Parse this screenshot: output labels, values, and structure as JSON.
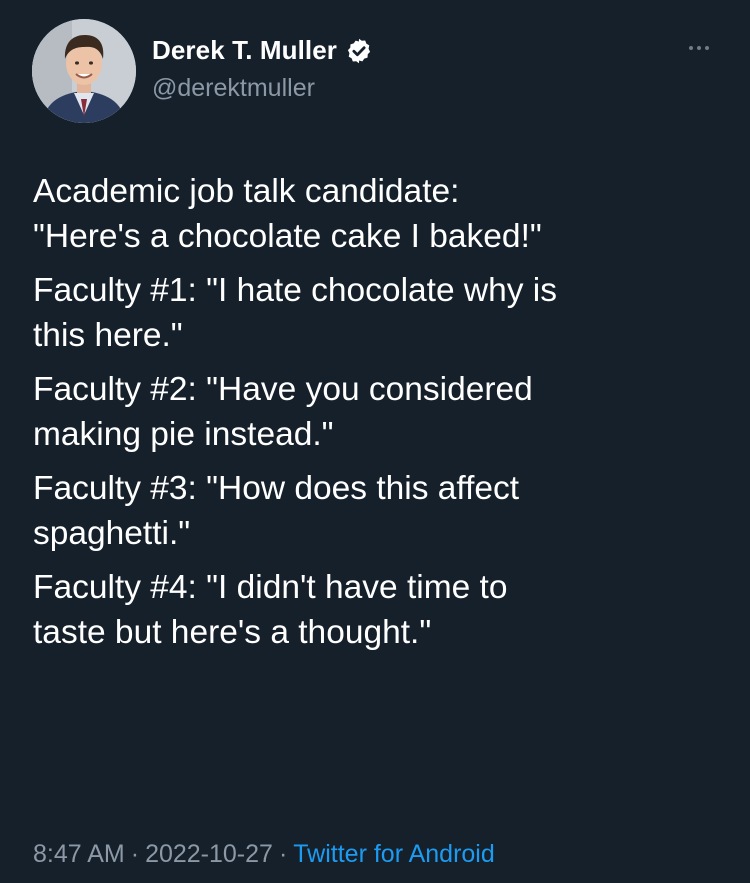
{
  "author": {
    "display_name": "Derek T. Muller",
    "handle": "@derektmuller",
    "verified": true,
    "avatar_icon": "profile-photo"
  },
  "tweet": {
    "paragraphs": [
      {
        "lines": [
          "Academic job talk candidate:",
          "\"Here's a chocolate cake I baked!\""
        ]
      },
      {
        "lines": [
          "Faculty #1: \"I hate chocolate why is",
          "this here.\""
        ]
      },
      {
        "lines": [
          "Faculty #2: \"Have you considered",
          "making pie instead.\""
        ]
      },
      {
        "lines": [
          "Faculty #3: \"How does this affect",
          "spaghetti.\""
        ]
      },
      {
        "lines": [
          "Faculty #4: \"I didn't have time to",
          "taste but here's a thought.\""
        ]
      }
    ]
  },
  "meta": {
    "time": "8:47 AM",
    "date": "2022-10-27",
    "separator": "·",
    "source": "Twitter for Android"
  },
  "colors": {
    "background": "#15202b",
    "text": "#ffffff",
    "secondary": "#8b98a5",
    "link": "#1d9bf0"
  },
  "icons": {
    "verified": "verified-badge-icon",
    "more": "more-options-icon"
  }
}
